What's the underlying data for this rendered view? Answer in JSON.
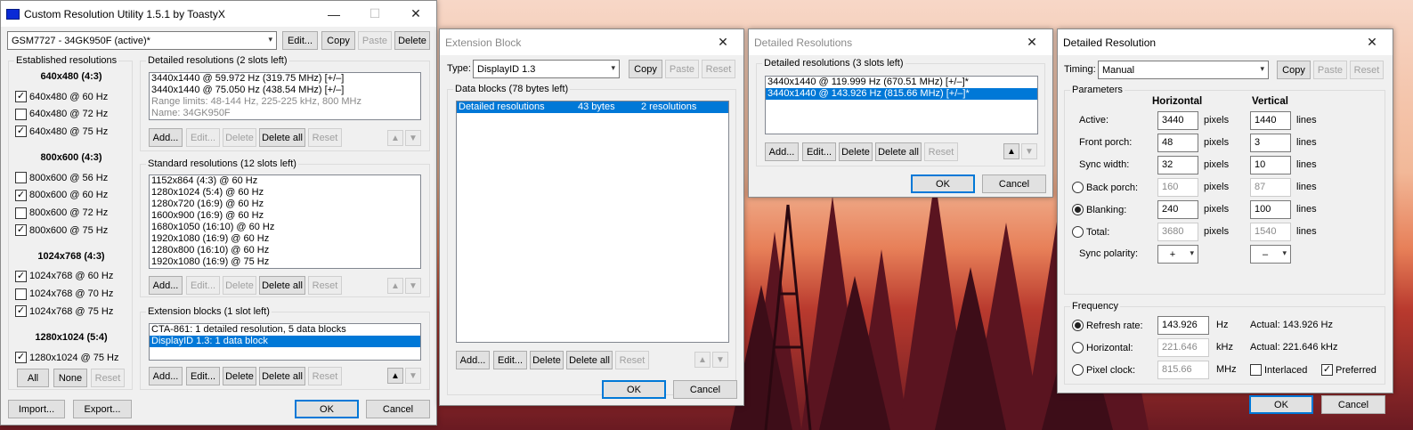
{
  "main": {
    "title": "Custom Resolution Utility 1.5.1 by ToastyX",
    "monitor": "GSM7727 - 34GK950F (active)*",
    "btn_edit": "Edit...",
    "btn_copy": "Copy",
    "btn_paste": "Paste",
    "btn_delete": "Delete",
    "established": {
      "label": "Established resolutions",
      "groups": [
        {
          "header": "640x480 (4:3)",
          "items": [
            {
              "label": "640x480 @ 60 Hz",
              "checked": true
            },
            {
              "label": "640x480 @ 72 Hz",
              "checked": false
            },
            {
              "label": "640x480 @ 75 Hz",
              "checked": true
            }
          ]
        },
        {
          "header": "800x600 (4:3)",
          "items": [
            {
              "label": "800x600 @ 56 Hz",
              "checked": false
            },
            {
              "label": "800x600 @ 60 Hz",
              "checked": true
            },
            {
              "label": "800x600 @ 72 Hz",
              "checked": false
            },
            {
              "label": "800x600 @ 75 Hz",
              "checked": true
            }
          ]
        },
        {
          "header": "1024x768 (4:3)",
          "items": [
            {
              "label": "1024x768 @ 60 Hz",
              "checked": true
            },
            {
              "label": "1024x768 @ 70 Hz",
              "checked": false
            },
            {
              "label": "1024x768 @ 75 Hz",
              "checked": true
            }
          ]
        },
        {
          "header": "1280x1024 (5:4)",
          "items": [
            {
              "label": "1280x1024 @ 75 Hz",
              "checked": true
            }
          ]
        }
      ],
      "btn_all": "All",
      "btn_none": "None",
      "btn_reset": "Reset"
    },
    "detailed": {
      "label": "Detailed resolutions (2 slots left)",
      "items": [
        "3440x1440 @ 59.972 Hz (319.75 MHz) [+/–]",
        "3440x1440 @ 75.050 Hz (438.54 MHz) [+/–]"
      ],
      "gray_items": [
        "Range limits: 48-144 Hz, 225-225 kHz, 800 MHz",
        "Name: 34GK950F"
      ]
    },
    "standard": {
      "label": "Standard resolutions (12 slots left)",
      "items": [
        "1152x864 (4:3) @ 60 Hz",
        "1280x1024 (5:4) @ 60 Hz",
        "1280x720 (16:9) @ 60 Hz",
        "1600x900 (16:9) @ 60 Hz",
        "1680x1050 (16:10) @ 60 Hz",
        "1920x1080 (16:9) @ 60 Hz",
        "1280x800 (16:10) @ 60 Hz",
        "1920x1080 (16:9) @ 75 Hz"
      ]
    },
    "extension": {
      "label": "Extension blocks (1 slot left)",
      "items": [
        "CTA-861: 1 detailed resolution, 5 data blocks",
        "DisplayID 1.3: 1 data block"
      ]
    },
    "list_buttons": {
      "add": "Add...",
      "edit": "Edit...",
      "delete": "Delete",
      "delete_all": "Delete all",
      "reset": "Reset"
    },
    "btn_import": "Import...",
    "btn_export": "Export...",
    "btn_ok": "OK",
    "btn_cancel": "Cancel"
  },
  "ext": {
    "title": "Extension Block",
    "type_label": "Type:",
    "type_value": "DisplayID 1.3",
    "btn_copy": "Copy",
    "btn_paste": "Paste",
    "btn_reset": "Reset",
    "data_blocks_label": "Data blocks (78 bytes left)",
    "rows": [
      {
        "name": "Detailed resolutions",
        "size": "43 bytes",
        "count": "2 resolutions"
      }
    ],
    "btn_add": "Add...",
    "btn_edit": "Edit...",
    "btn_delete": "Delete",
    "btn_delete_all": "Delete all",
    "btn_reset2": "Reset",
    "btn_ok": "OK",
    "btn_cancel": "Cancel"
  },
  "dres": {
    "title": "Detailed Resolutions",
    "label": "Detailed resolutions (3 slots left)",
    "items": [
      "3440x1440 @ 119.999 Hz (670.51 MHz) [+/–]*",
      "3440x1440 @ 143.926 Hz (815.66 MHz) [+/–]*"
    ],
    "btn_add": "Add...",
    "btn_edit": "Edit...",
    "btn_delete": "Delete",
    "btn_delete_all": "Delete all",
    "btn_reset": "Reset",
    "btn_ok": "OK",
    "btn_cancel": "Cancel"
  },
  "dr": {
    "title": "Detailed Resolution",
    "timing_label": "Timing:",
    "timing_value": "Manual",
    "btn_copy": "Copy",
    "btn_paste": "Paste",
    "btn_reset": "Reset",
    "params_label": "Parameters",
    "col_h": "Horizontal",
    "col_v": "Vertical",
    "rows": [
      {
        "label": "Active:",
        "h": "3440",
        "v": "1440",
        "radio": null,
        "disabled": false
      },
      {
        "label": "Front porch:",
        "h": "48",
        "v": "3",
        "radio": null,
        "disabled": false
      },
      {
        "label": "Sync width:",
        "h": "32",
        "v": "10",
        "radio": null,
        "disabled": false
      },
      {
        "label": "Back porch:",
        "h": "160",
        "v": "87",
        "radio": false,
        "disabled": true
      },
      {
        "label": "Blanking:",
        "h": "240",
        "v": "100",
        "radio": true,
        "disabled": false
      },
      {
        "label": "Total:",
        "h": "3680",
        "v": "1540",
        "radio": false,
        "disabled": true
      }
    ],
    "unit_h": "pixels",
    "unit_v": "lines",
    "sync_label": "Sync polarity:",
    "sync_h": "+",
    "sync_v": "–",
    "freq_label": "Frequency",
    "refresh_label": "Refresh rate:",
    "refresh_value": "143.926",
    "refresh_unit": "Hz",
    "refresh_actual": "Actual: 143.926 Hz",
    "horiz_label": "Horizontal:",
    "horiz_value": "221.646",
    "horiz_unit": "kHz",
    "horiz_actual": "Actual: 221.646 kHz",
    "pclk_label": "Pixel clock:",
    "pclk_value": "815.66",
    "pclk_unit": "MHz",
    "interlaced": "Interlaced",
    "preferred": "Preferred",
    "btn_ok": "OK",
    "btn_cancel": "Cancel"
  }
}
